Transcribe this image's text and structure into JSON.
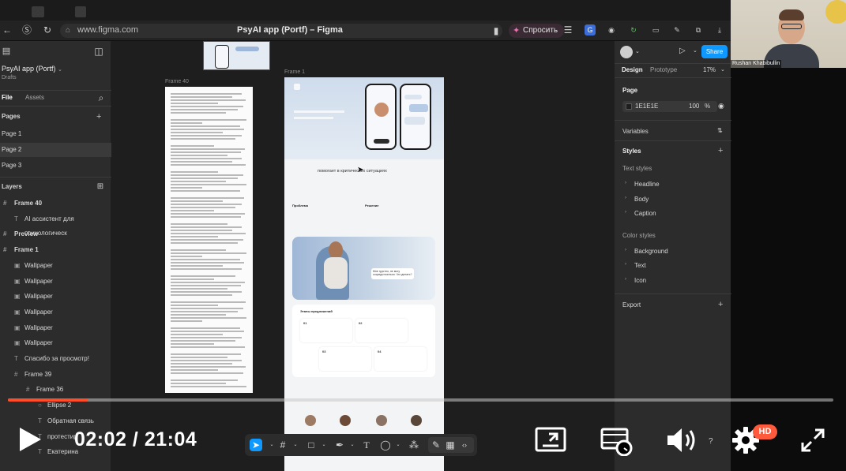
{
  "browser": {
    "url": "www.figma.com",
    "page_title": "PsyAI app (Portf) – Figma",
    "ask_button": "Спросить"
  },
  "figma": {
    "file_name": "PsyAI app (Portf)",
    "file_location": "Drafts",
    "tabs": [
      "File",
      "Assets"
    ],
    "pages_header": "Pages",
    "pages": [
      "Page 1",
      "Page 2",
      "Page 3"
    ],
    "active_page": "Page 2",
    "layers_header": "Layers",
    "layers": [
      {
        "label": "Frame 40",
        "icon": "#",
        "level": 0
      },
      {
        "label": "AI ассистент для психологическ",
        "icon": "T",
        "level": 1
      },
      {
        "label": "Preview",
        "icon": "#",
        "level": 0
      },
      {
        "label": "Frame 1",
        "icon": "#",
        "level": 0
      },
      {
        "label": "Wallpaper",
        "icon": "▣",
        "level": 1
      },
      {
        "label": "Wallpaper",
        "icon": "▣",
        "level": 1
      },
      {
        "label": "Wallpaper",
        "icon": "▣",
        "level": 1
      },
      {
        "label": "Wallpaper",
        "icon": "▣",
        "level": 1
      },
      {
        "label": "Wallpaper",
        "icon": "▣",
        "level": 1
      },
      {
        "label": "Wallpaper",
        "icon": "▣",
        "level": 1
      },
      {
        "label": "Спасибо за просмотр!",
        "icon": "T",
        "level": 1
      },
      {
        "label": "Frame 39",
        "icon": "#",
        "level": 1
      },
      {
        "label": "Frame 36",
        "icon": "#",
        "level": 2
      },
      {
        "label": "Ellipse 2",
        "icon": "○",
        "level": 3
      },
      {
        "label": "Обратная связь",
        "icon": "T",
        "level": 3
      },
      {
        "label": "протестир",
        "icon": "T",
        "level": 3
      },
      {
        "label": "Екатерина",
        "icon": "T",
        "level": 3
      }
    ],
    "canvas": {
      "frame_40_label": "Frame 40",
      "frame_1_label": "Frame 1",
      "hero_heading": "помогает в критических ситуациях",
      "problem_heading": "Проблема",
      "solution_heading": "Решение",
      "cards_heading": "Этапы предложений",
      "card_numbers": [
        "01",
        "02",
        "03",
        "04"
      ],
      "bubble_text": "Мне грустно, не могу сосредоточиться. Что делать?"
    },
    "right": {
      "tabs": [
        "Design",
        "Prototype"
      ],
      "zoom": "17%",
      "share_label": "Share",
      "page_section": "Page",
      "page_color_hex": "1E1E1E",
      "page_opacity": "100",
      "page_opacity_unit": "%",
      "variables": "Variables",
      "styles": "Styles",
      "text_styles_header": "Text styles",
      "text_styles": [
        "Headline",
        "Body",
        "Caption"
      ],
      "color_styles_header": "Color styles",
      "color_styles": [
        "Background",
        "Text",
        "Icon"
      ],
      "export": "Export"
    }
  },
  "webcam": {
    "name": "Rushan Khabibullin"
  },
  "video": {
    "current_time": "02:02",
    "separator": "/",
    "duration": "21:04",
    "progress_fraction": 0.097,
    "quality_badge": "HD",
    "speed_label": "?"
  },
  "colors": {
    "accent": "#0d99ff",
    "progress": "#ff4d2a",
    "hd_badge": "#ff5a3c"
  }
}
